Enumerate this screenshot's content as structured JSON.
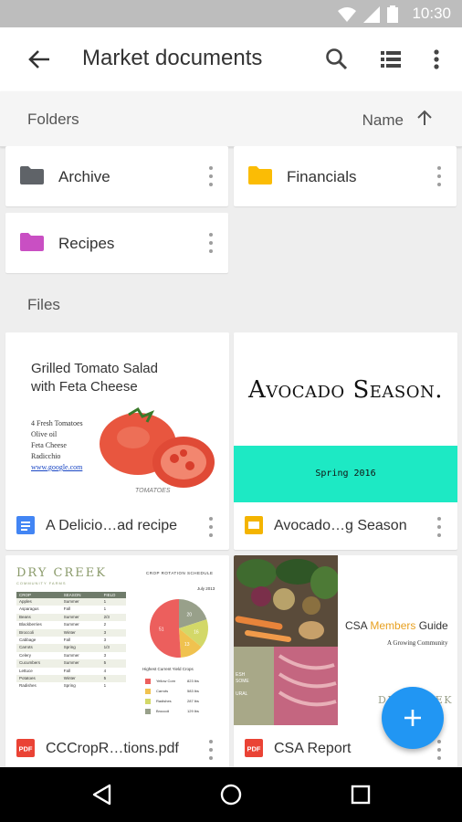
{
  "status": {
    "time": "10:30"
  },
  "appbar": {
    "title": "Market documents"
  },
  "sortbar": {
    "left": "Folders",
    "sort_label": "Name"
  },
  "folders": [
    {
      "label": "Archive",
      "color": "#5f6368"
    },
    {
      "label": "Financials",
      "color": "#fbbc05"
    },
    {
      "label": "Recipes",
      "color": "#c94fc3"
    }
  ],
  "sections": {
    "files": "Files"
  },
  "files": [
    {
      "name": "A Delicio…ad recipe",
      "type_icon": "docs-icon",
      "thumb": {
        "title_line1": "Grilled Tomato Salad",
        "title_line2": "with Feta Cheese",
        "ingredients": [
          "4 Fresh Tomatoes",
          "Olive oil",
          "Feta Cheese",
          "Radicchio"
        ],
        "link": "www.google.com",
        "caption": "TOMATOES"
      }
    },
    {
      "name": "Avocado…g Season",
      "type_icon": "slides-icon",
      "thumb": {
        "title": "Avocado Season.",
        "subtitle": "Spring 2016"
      }
    },
    {
      "name": "CCCropR…tions.pdf",
      "type_icon": "pdf-icon",
      "thumb": {
        "farm": "DRY CREEK",
        "farm_sub": "COMMUNITY FARMS",
        "schedule_title": "CROP ROTATION SCHEDULE",
        "schedule_date": "July 2013",
        "table_header": [
          "CROP",
          "SEASON",
          "FIELD"
        ],
        "rows": [
          [
            "Apples",
            "Summer",
            "1"
          ],
          [
            "Asparagus",
            "Fall",
            "1"
          ],
          [
            "Beans",
            "Summer",
            "2/3"
          ],
          [
            "Blackberries",
            "Summer",
            "2"
          ],
          [
            "Broccoli",
            "Winter",
            "3"
          ],
          [
            "Cabbage",
            "Fall",
            "3"
          ],
          [
            "Carrots",
            "Spring",
            "1/3"
          ],
          [
            "Celery",
            "Summer",
            "3"
          ],
          [
            "Cucumbers",
            "Summer",
            "5"
          ],
          [
            "Lettuce",
            "Fall",
            "4"
          ],
          [
            "Potatoes",
            "Winter",
            "5"
          ],
          [
            "Radishes",
            "Spring",
            "1"
          ]
        ],
        "pie_values": [
          "20",
          "16",
          "13",
          "51"
        ],
        "pie_colors": [
          "#98a08a",
          "#d3d868",
          "#f0c24f",
          "#ec5f5d"
        ],
        "yield_title": "Highest Current Yield Crops",
        "legend": [
          [
            "Yellow Corn",
            "823 lbs"
          ],
          [
            "Carrots",
            "583 lbs"
          ],
          [
            "Radishes",
            "287 lbs"
          ],
          [
            "Broccoli",
            "129 lbs"
          ]
        ]
      }
    },
    {
      "name": "CSA Report",
      "type_icon": "pdf-icon",
      "thumb": {
        "title_a": "CSA ",
        "title_b": "Members",
        "title_c": " Guide",
        "subtitle": "A Growing Community",
        "side_text": "ESH\nSOME\n\nURAL",
        "corner": "DRY CREEK"
      }
    }
  ]
}
